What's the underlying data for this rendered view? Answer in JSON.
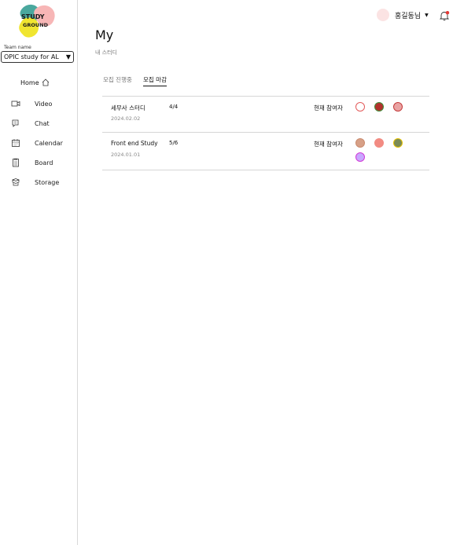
{
  "logo": {
    "line1": "STUDY",
    "line2": "GROUND"
  },
  "team": {
    "label": "Team name",
    "selected": "OPIC study for AL"
  },
  "nav": {
    "home": "Home",
    "items": [
      {
        "label": "Video",
        "icon": "video-icon"
      },
      {
        "label": "Chat",
        "icon": "chat-icon"
      },
      {
        "label": "Calendar",
        "icon": "calendar-icon"
      },
      {
        "label": "Board",
        "icon": "board-icon"
      },
      {
        "label": "Storage",
        "icon": "storage-icon"
      }
    ]
  },
  "header": {
    "username": "홍길동님",
    "dropdown": "▼"
  },
  "page": {
    "title": "My",
    "subtitle": "내 스터디"
  },
  "tabs": [
    {
      "label": "모집 진행중",
      "active": false
    },
    {
      "label": "모집 마감",
      "active": true
    }
  ],
  "studies": [
    {
      "name": "세무사 스터디",
      "date": "2024.02.02",
      "count": "4/4",
      "participants_label": "현재 참여자",
      "participants": [
        {
          "fill": "#ffffff",
          "border": "#e35b5b"
        },
        {
          "fill": "#b2332d",
          "border": "#3f8c3a"
        },
        {
          "fill": "#e9a3a3",
          "border": "#c43a3a"
        }
      ]
    },
    {
      "name": "Front end Study",
      "date": "2024.01.01",
      "count": "5/6",
      "participants_label": "현재 참여자",
      "participants": [
        {
          "fill": "#d7a087",
          "border": "#c98b6e"
        },
        {
          "fill": "#f28b82",
          "border": "#f28b82"
        },
        {
          "fill": "#7a8a55",
          "border": "#e5c100"
        },
        {
          "fill": "#c9a7ff",
          "border": "#d23ad6"
        }
      ]
    }
  ],
  "colors": {
    "accent_yellow": "#f0e530",
    "accent_teal": "#4aa89e",
    "accent_pink": "#f7b6b6",
    "notification": "#e53935"
  }
}
